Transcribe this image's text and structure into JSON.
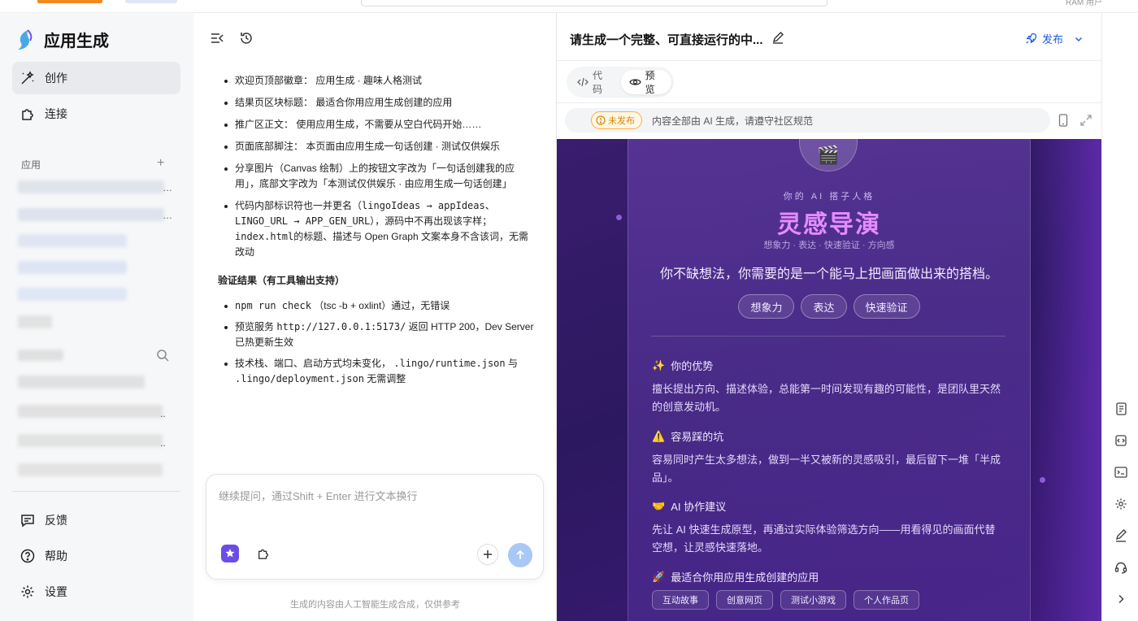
{
  "topbar": {
    "user_label": "RAM 用户"
  },
  "sidebar": {
    "brand_title": "应用生成",
    "nav": [
      {
        "label": "创作",
        "icon": "wand-icon",
        "active": true
      },
      {
        "label": "连接",
        "icon": "puzzle-icon",
        "active": false
      }
    ],
    "apps_section_label": "应用",
    "footer": [
      {
        "label": "反馈",
        "icon": "feedback-icon"
      },
      {
        "label": "帮助",
        "icon": "help-icon"
      },
      {
        "label": "设置",
        "icon": "settings-icon"
      }
    ]
  },
  "chat": {
    "bullets": [
      "欢迎页顶部徽章： 应用生成 · 趣味人格测试",
      "结果页区块标题： 最适合你用应用生成创建的应用",
      "推广区正文： 使用应用生成，不需要从空白代码开始……",
      "页面底部脚注： 本页面由应用生成一句话创建 · 测试仅供娱乐",
      "分享图片（Canvas 绘制）上的按钮文字改为「一句话创建我的应用」，底部文字改为「本测试仅供娱乐 · 由应用生成一句话创建」"
    ],
    "bullet6": {
      "a": "代码内部标识符也一并更名（",
      "code1": "lingoIdeas → appIdeas",
      "b": "、",
      "code2": "LINGO_URL → APP_GEN_URL",
      "c": "），源码中不再出现该字样；",
      "code3": "index.html",
      "d": "的标题、描述与 Open Graph 文案本身不含该词，无需改动"
    },
    "verify_heading": "验证结果（有工具输出支持）",
    "verify": [
      {
        "code": "npm run check",
        "text": "（tsc -b + oxlint）通过，无错误"
      },
      {
        "text_pre": "预览服务",
        "code": "http://127.0.0.1:5173/",
        "text": "返回 HTTP 200，Dev Server 已热更新生效"
      },
      {
        "text_pre": "技术栈、端口、启动方式均未变化，",
        "code": ".lingo/runtime.json",
        "mid": "与",
        "code2": ".lingo/deployment.json",
        "text": "无需调整"
      }
    ],
    "input_placeholder": "继续提问，通过Shift + Enter 进行文本换行",
    "footnote": "生成的内容由人工智能生成合成，仅供参考"
  },
  "preview": {
    "title": "请生成一个完整、可直接运行的中...",
    "publish_label": "发布",
    "tabs": [
      {
        "label": "代码",
        "active": false
      },
      {
        "label": "预览",
        "active": true
      }
    ],
    "status_badge": "未发布",
    "notice": "内容全部由 AI 生成，请遵守社区规范",
    "app": {
      "clap_emoji": "🎬",
      "eyebrow": "你的 AI 搭子人格",
      "title": "灵感导演",
      "subtitle": "想象力 · 表达 · 快速验证 · 方向感",
      "lead": "你不缺想法，你需要的是一个能马上把画面做出来的搭档。",
      "chips": [
        "想象力",
        "表达",
        "快速验证"
      ],
      "sections": [
        {
          "emoji": "✨",
          "heading": "你的优势",
          "body": "擅长提出方向、描述体验，总能第一时间发现有趣的可能性，是团队里天然的创意发动机。"
        },
        {
          "emoji": "⚠️",
          "heading": "容易踩的坑",
          "body": "容易同时产生太多想法，做到一半又被新的灵感吸引，最后留下一堆「半成品」。"
        },
        {
          "emoji": "🤝",
          "heading": "AI 协作建议",
          "body": "先让 AI 快速生成原型，再通过实际体验筛选方向——用看得见的画面代替空想，让灵感快速落地。"
        },
        {
          "emoji": "🚀",
          "heading": "最适合你用应用生成创建的应用",
          "body": ""
        }
      ],
      "tags": [
        "互动故事",
        "创意网页",
        "测试小游戏",
        "个人作品页"
      ]
    }
  },
  "colors": {
    "accent": "#1f5ce6",
    "brand": "#6c4ce6",
    "preview_bg": "#2c1860",
    "title_pink": "#e58bff"
  }
}
